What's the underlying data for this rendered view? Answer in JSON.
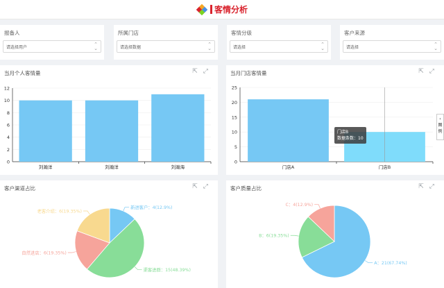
{
  "header": {
    "title": "客情分析"
  },
  "filters": [
    {
      "label": "报备人",
      "placeholder": "请选择用户"
    },
    {
      "label": "所属门店",
      "placeholder": "请选择数据"
    },
    {
      "label": "客情分级",
      "placeholder": "请选择"
    },
    {
      "label": "客户来源",
      "placeholder": "请选择"
    }
  ],
  "panels": {
    "personal": {
      "title": "当月个人客情量"
    },
    "store": {
      "title": "当月门店客情量"
    },
    "channel": {
      "title": "客户渠道占比"
    },
    "quality": {
      "title": "客户质量占比"
    }
  },
  "side_handle": {
    "arrow": "‹",
    "text": "图例"
  },
  "tooltip": {
    "title": "门店B",
    "line": "数据条数：10"
  },
  "colors": {
    "bar": "#76c8f4",
    "bar_highlight": "#7fdcfb",
    "brand_red": "#d9232d"
  },
  "chart_data": [
    {
      "type": "bar",
      "title": "当月个人客情量",
      "categories": [
        "刘瀚洋",
        "刘瀚洋",
        "刘瀚海"
      ],
      "values": [
        10,
        10,
        11
      ],
      "ylim": [
        0,
        12
      ],
      "yticks": [
        "0",
        "2",
        "4",
        "6",
        "8",
        "10",
        "12"
      ]
    },
    {
      "type": "bar",
      "title": "当月门店客情量",
      "categories": [
        "门店A",
        "门店B"
      ],
      "values": [
        21,
        10
      ],
      "ylim": [
        0,
        25
      ],
      "yticks": [
        "0",
        "5",
        "10",
        "15",
        "20",
        "25"
      ]
    },
    {
      "type": "pie",
      "title": "客户渠道占比",
      "slices": [
        {
          "label": "新进客户：4(12.9%)",
          "value": 4,
          "color": "#76c8f4"
        },
        {
          "label": "渠客进群：15(48.39%)",
          "value": 15,
          "color": "#88dd98"
        },
        {
          "label": "自然进店：6(19.35%)",
          "value": 6,
          "color": "#f6a49b"
        },
        {
          "label": "老客介绍：6(19.35%)",
          "value": 6,
          "color": "#f8d98f"
        }
      ]
    },
    {
      "type": "pie",
      "title": "客户质量占比",
      "slices": [
        {
          "label": "A：21(67.74%)",
          "value": 21,
          "color": "#76c8f4"
        },
        {
          "label": "B：6(19.35%)",
          "value": 6,
          "color": "#88dd98"
        },
        {
          "label": "C：4(12.9%)",
          "value": 4,
          "color": "#f6a49b"
        }
      ]
    }
  ]
}
